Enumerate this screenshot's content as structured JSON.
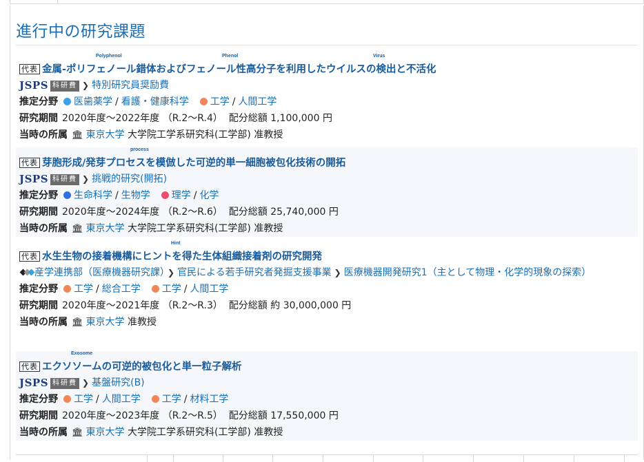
{
  "section_title": "進行中の研究課題",
  "labels": {
    "field": "推定分野",
    "period": "研究期間",
    "affiliation": "当時の所属",
    "representative": "代表"
  },
  "colors": {
    "link": "#1a6fb5",
    "dot_blue": "#3aa0e8",
    "dot_orange": "#f0875a",
    "dot_red": "#f04a6a",
    "dot_darkblue": "#2f6fe0"
  },
  "projects": [
    {
      "representative": true,
      "title": "金属-ポリフェノール錯体およびフェノール性高分子を利用したウイルスの検出と不活化",
      "ruby": [
        "Polyphenol",
        "Phenol",
        "Virus"
      ],
      "funder_jsps": "JSPS",
      "funder_kakenhi": "科研費",
      "program": [
        "特別研究員奨励費"
      ],
      "fields": [
        {
          "dot": "blue",
          "parts": [
            "医歯薬学",
            "看護・健康科学"
          ]
        },
        {
          "dot": "orange",
          "parts": [
            "工学",
            "人間工学"
          ]
        }
      ],
      "period": "2020年度〜2022年度 （R.2〜R.4）",
      "budget_label": "配分総額",
      "budget": "1,100,000 円",
      "institution": "東京大学",
      "department": "大学院工学系研究科(工学部) 准教授"
    },
    {
      "representative": true,
      "title": "芽胞形成/発芽プロセスを模倣した可逆的単一細胞被包化技術の開拓",
      "ruby": [
        "process"
      ],
      "funder_jsps": "JSPS",
      "funder_kakenhi": "科研費",
      "program": [
        "挑戦的研究(開拓)"
      ],
      "fields": [
        {
          "dot": "darkblue",
          "parts": [
            "生命科学",
            "生物学"
          ]
        },
        {
          "dot": "red",
          "parts": [
            "理学",
            "化学"
          ]
        }
      ],
      "period": "2020年度〜2024年度 （R.2〜R.6）",
      "budget_label": "配分総額",
      "budget": "25,740,000 円",
      "institution": "東京大学",
      "department": "大学院工学系研究科(工学部) 准教授"
    },
    {
      "representative": false,
      "title": "水生生物の接着機構にヒントを得た生体組織接着剤の研究開発",
      "ruby": [
        "Hint"
      ],
      "program": [
        "産学連携部（医療機器研究課）",
        "官民による若手研究者発掘支援事業",
        "医療機器開発研究1（主として物理・化学的現象の探索）"
      ],
      "fields": [
        {
          "dot": "orange",
          "parts": [
            "工学",
            "総合工学"
          ]
        },
        {
          "dot": "orange",
          "parts": [
            "工学",
            "人間工学"
          ]
        }
      ],
      "period": "2020年度〜2021年度 （R.2〜R.3）",
      "budget_label": "配分総額",
      "budget": "約 30,000,000 円",
      "institution": "東京大学",
      "department": "准教授"
    },
    {
      "representative": true,
      "title": "エクソソームの可逆的被包化と単一粒子解析",
      "ruby": [
        "Exosome"
      ],
      "funder_jsps": "JSPS",
      "funder_kakenhi": "科研費",
      "program": [
        "基盤研究(B)"
      ],
      "fields": [
        {
          "dot": "orange",
          "parts": [
            "工学",
            "人間工学"
          ]
        },
        {
          "dot": "orange",
          "parts": [
            "工学",
            "材料工学"
          ]
        }
      ],
      "period": "2020年度〜2023年度 （R.2〜R.5）",
      "budget_label": "配分総額",
      "budget": "17,550,000 円",
      "institution": "東京大学",
      "department": "大学院工学系研究科(工学部) 准教授"
    }
  ]
}
